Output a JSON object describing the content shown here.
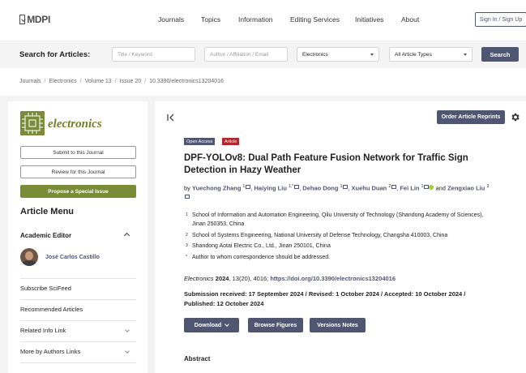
{
  "topnav": {
    "logo": "MDPI",
    "items": [
      "Journals",
      "Topics",
      "Information",
      "Editing Services",
      "Initiatives",
      "About"
    ],
    "sign_in": "Sign In / Sign Up"
  },
  "search": {
    "title": "Search for Articles:",
    "keyword_placeholder": "Title / Keyword",
    "author_placeholder": "Author / Affiliation / Email",
    "journal_select": "Electronics",
    "type_select": "All Article Types",
    "button": "Search"
  },
  "breadcrumb": [
    "Journals",
    "Electronics",
    "Volume 13",
    "Issue 20",
    "10.3390/electronics13204016"
  ],
  "sidebar": {
    "journal_name": "electronics",
    "submit": "Submit to this Journal",
    "review": "Review for this Journal",
    "propose": "Propose a Special Issue",
    "menu_title": "Article Menu",
    "academic_editor_label": "Academic Editor",
    "editor_name": "José Carlos Castillo",
    "links": [
      "Subscribe SciFeed",
      "Recommended Articles",
      "Related Info Link",
      "More by Authors Links"
    ]
  },
  "article": {
    "order_reprints": "Order Article Reprints",
    "badge_open_access": "Open Access",
    "badge_article": "Article",
    "title": "DPF-YOLOv8: Dual Path Feature Fusion Network for Traffic Sign Detection in Hazy Weather",
    "by": "by",
    "authors": [
      {
        "name": "Yuechong Zhang",
        "sup": "1"
      },
      {
        "name": "Haiying Liu",
        "sup": "1,*"
      },
      {
        "name": "Dehao Dong",
        "sup": "1"
      },
      {
        "name": "Xuehu Duan",
        "sup": "2"
      },
      {
        "name": "Fei Lin",
        "sup": "1"
      },
      {
        "name": "Zengxiao Liu",
        "sup": "3"
      }
    ],
    "and": "and",
    "affiliations": [
      {
        "n": "1",
        "text": "School of Information and Automation Engineering, Qilu University of Technology (Shandong Academy of Sciences), Jinan 250353, China"
      },
      {
        "n": "2",
        "text": "School of Systems Engineering, National University of Defense Technology, Changsha 410003, China"
      },
      {
        "n": "3",
        "text": "Shandong Aotai Electric Co., Ltd., Jinan 250101, China"
      },
      {
        "n": "*",
        "text": "Author to whom correspondence should be addressed."
      }
    ],
    "journal": "Electronics",
    "year": "2024",
    "volume_issue": ", 13(20), 4016; ",
    "doi": "https://doi.org/10.3390/electronics13204016",
    "dates": "Submission received: 17 September 2024 / Revised: 1 October 2024 / Accepted: 10 October 2024 / Published: 12 October 2024",
    "download": "Download",
    "browse_figures": "Browse Figures",
    "versions_notes": "Versions Notes",
    "abstract_heading": "Abstract"
  }
}
